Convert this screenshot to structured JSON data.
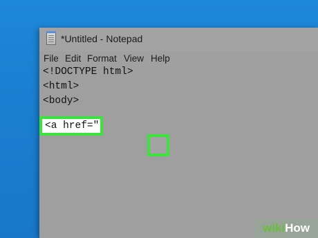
{
  "window": {
    "title": "*Untitled - Notepad",
    "app_icon": "notepad-icon"
  },
  "menu": {
    "file": "File",
    "edit": "Edit",
    "format": "Format",
    "view": "View",
    "help": "Help"
  },
  "editor": {
    "lines": [
      "<!DOCTYPE html>",
      "<html>",
      "<body>",
      ""
    ],
    "highlighted_text": "<a href=\""
  },
  "watermark": {
    "part1": "wiki",
    "part2": "How"
  },
  "colors": {
    "desktop_blue": "#1a7fd0",
    "highlight_green": "#3ce33c",
    "window_gray": "#9f9f9f"
  }
}
